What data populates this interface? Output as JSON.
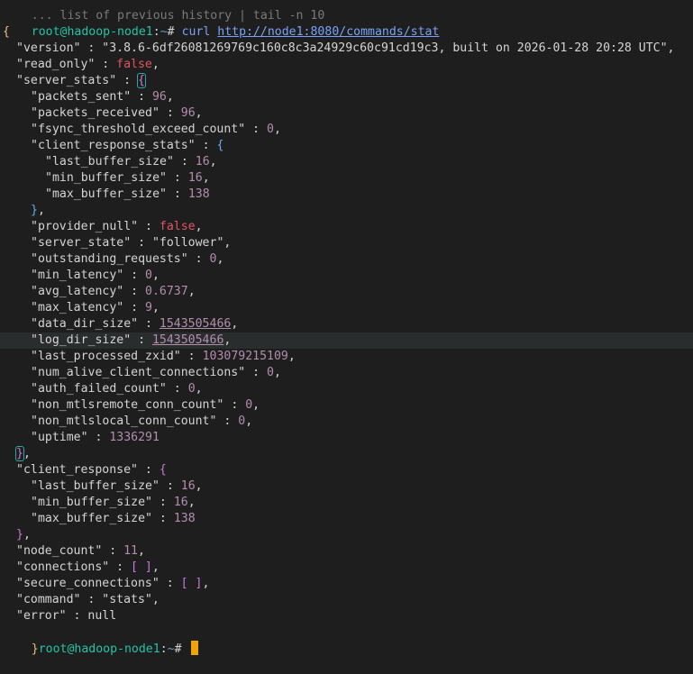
{
  "top_fragment": "... list of previous history | tail -n 10",
  "prompt": {
    "user_host": "root@hadoop-node1",
    "sep": ":",
    "path": "~",
    "symbol": "#"
  },
  "command": {
    "name": "curl",
    "url": "http://node1:8080/commands/stat"
  },
  "json": {
    "version": "\"3.8.6-6df26081269769c160c8c3a24929c60c91cd19c3, built on 2026-01-28 20:28 UTC\"",
    "read_only": "false",
    "server_stats": {
      "packets_sent": "96",
      "packets_received": "96",
      "fsync_threshold_exceed_count": "0",
      "client_response_stats": {
        "last_buffer_size": "16",
        "min_buffer_size": "16",
        "max_buffer_size": "138"
      },
      "provider_null": "false",
      "server_state": "\"follower\"",
      "outstanding_requests": "0",
      "min_latency": "0",
      "avg_latency": "0.6737",
      "max_latency": "9",
      "data_dir_size": "1543505466",
      "log_dir_size": "1543505466",
      "last_processed_zxid": "103079215109",
      "num_alive_client_connections": "0",
      "auth_failed_count": "0",
      "non_mtlsremote_conn_count": "0",
      "non_mtlslocal_conn_count": "0",
      "uptime": "1336291"
    },
    "client_response": {
      "last_buffer_size": "16",
      "min_buffer_size": "16",
      "max_buffer_size": "138"
    },
    "node_count": "11",
    "connections": "[ ]",
    "secure_connections": "[ ]",
    "command": "\"stats\"",
    "error": "null"
  },
  "keys": {
    "version": "\"version\"",
    "read_only": "\"read_only\"",
    "server_stats": "\"server_stats\"",
    "packets_sent": "\"packets_sent\"",
    "packets_received": "\"packets_received\"",
    "fsync_threshold_exceed_count": "\"fsync_threshold_exceed_count\"",
    "client_response_stats": "\"client_response_stats\"",
    "last_buffer_size": "\"last_buffer_size\"",
    "min_buffer_size": "\"min_buffer_size\"",
    "max_buffer_size": "\"max_buffer_size\"",
    "provider_null": "\"provider_null\"",
    "server_state": "\"server_state\"",
    "outstanding_requests": "\"outstanding_requests\"",
    "min_latency": "\"min_latency\"",
    "avg_latency": "\"avg_latency\"",
    "max_latency": "\"max_latency\"",
    "data_dir_size": "\"data_dir_size\"",
    "log_dir_size": "\"log_dir_size\"",
    "last_processed_zxid": "\"last_processed_zxid\"",
    "num_alive_client_connections": "\"num_alive_client_connections\"",
    "auth_failed_count": "\"auth_failed_count\"",
    "non_mtlsremote_conn_count": "\"non_mtlsremote_conn_count\"",
    "non_mtlslocal_conn_count": "\"non_mtlslocal_conn_count\"",
    "uptime": "\"uptime\"",
    "client_response": "\"client_response\"",
    "node_count": "\"node_count\"",
    "connections": "\"connections\"",
    "secure_connections": "\"secure_connections\"",
    "command": "\"command\"",
    "error": "\"error\""
  },
  "syntax": {
    "colon": " : ",
    "comma": ",",
    "open_brace": "{",
    "close_brace": "}"
  },
  "colors": {
    "background": "#1e1e1e",
    "prompt_user": "#23c4a7",
    "prompt_path": "#5b9bd5",
    "number": "#b48ead",
    "boolean": "#e05561",
    "cursor": "#f0a30a",
    "highlight_line": "#2a2d2e"
  }
}
